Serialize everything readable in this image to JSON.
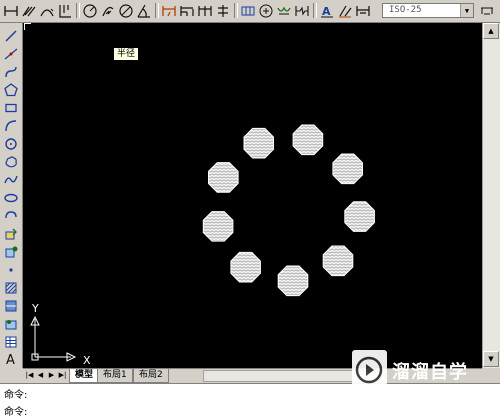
{
  "toolbar": {
    "buttons": [
      "linear-dim-icon",
      "aligned-dim-icon",
      "arc-length-dim-icon",
      "ordinate-dim-icon",
      "radius-dim-icon",
      "jogged-dim-icon",
      "diameter-dim-icon",
      "angular-dim-icon",
      "quick-dim-icon",
      "baseline-dim-icon",
      "continue-dim-icon",
      "dim-space-icon",
      "dim-break-icon",
      "tolerance-icon",
      "center-mark-icon",
      "inspect-icon",
      "jogged-linear-icon",
      "dimedit-icon",
      "dimtedit-icon",
      "dim-update-icon"
    ],
    "dimstyle_value": "ISO-25"
  },
  "left_toolbar": [
    "line-icon",
    "construction-line-icon",
    "polyline-icon",
    "polygon-icon",
    "rectangle-icon",
    "arc-icon",
    "circle-icon",
    "revision-cloud-icon",
    "spline-icon",
    "ellipse-icon",
    "ellipse-arc-icon",
    "insert-block-icon",
    "make-block-icon",
    "point-icon",
    "hatch-icon",
    "gradient-icon",
    "region-icon",
    "table-icon",
    "mtext-icon"
  ],
  "tooltip": "半径",
  "ucs": {
    "y_label": "Y",
    "x_label": "X"
  },
  "tabs": [
    {
      "label": "模型",
      "active": true
    },
    {
      "label": "布局1",
      "active": false
    },
    {
      "label": "布局2",
      "active": false
    }
  ],
  "command": {
    "line1": "命令:",
    "line2": "命令:"
  },
  "watermark": {
    "brand": "溜溜自学",
    "url": "ZIXUE.3D66.COM"
  },
  "colors": {
    "canvas": "#000000",
    "hatch": "#ffffff"
  },
  "drawing": {
    "polygon_count": 9
  }
}
